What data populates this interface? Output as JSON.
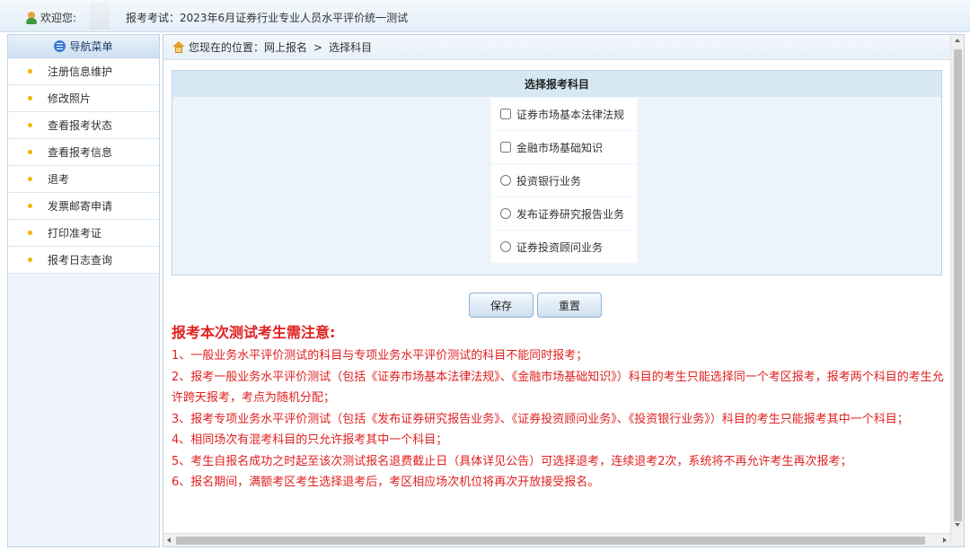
{
  "topbar": {
    "welcome": "欢迎您:",
    "exam": "报考考试：2023年6月证券行业专业人员水平评价统一测试"
  },
  "sidebar": {
    "header": "导航菜单",
    "items": [
      {
        "label": "注册信息维护"
      },
      {
        "label": "修改照片"
      },
      {
        "label": "查看报考状态"
      },
      {
        "label": "查看报考信息"
      },
      {
        "label": "退考"
      },
      {
        "label": "发票邮寄申请"
      },
      {
        "label": "打印准考证"
      },
      {
        "label": "报考日志查询"
      }
    ]
  },
  "breadcrumb": {
    "prefix": "您现在的位置：网上报名",
    "separator": ">",
    "current": "选择科目"
  },
  "subjects": {
    "title": "选择报考科目",
    "options": [
      {
        "label": "证券市场基本法律法规",
        "type": "checkbox"
      },
      {
        "label": "金融市场基础知识",
        "type": "checkbox"
      },
      {
        "label": "投资银行业务",
        "type": "radio"
      },
      {
        "label": "发布证券研究报告业务",
        "type": "radio"
      },
      {
        "label": "证券投资顾问业务",
        "type": "radio"
      }
    ]
  },
  "buttons": {
    "save": "保存",
    "reset": "重置"
  },
  "notice": {
    "title": "报考本次测试考生需注意:",
    "lines": [
      "1、一般业务水平评价测试的科目与专项业务水平评价测试的科目不能同时报考；",
      "2、报考一般业务水平评价测试（包括《证券市场基本法律法规》、《金融市场基础知识》）科目的考生只能选择同一个考区报考，报考两个科目的考生允许跨天报考，考点为随机分配；",
      "3、报考专项业务水平评价测试（包括《发布证券研究报告业务》、《证券投资顾问业务》、《投资银行业务》）科目的考生只能报考其中一个科目；",
      "4、相同场次有混考科目的只允许报考其中一个科目；",
      "5、考生自报名成功之时起至该次测试报名退费截止日（具体详见公告）可选择退考，连续退考2次，系统将不再允许考生再次报考；",
      "6、报名期间，满额考区考生选择退考后，考区相应场次机位将再次开放接受报名。"
    ]
  },
  "colors": {
    "accent": "#3a7bd5",
    "notice": "#e02020",
    "bullet": "#f0b400"
  }
}
